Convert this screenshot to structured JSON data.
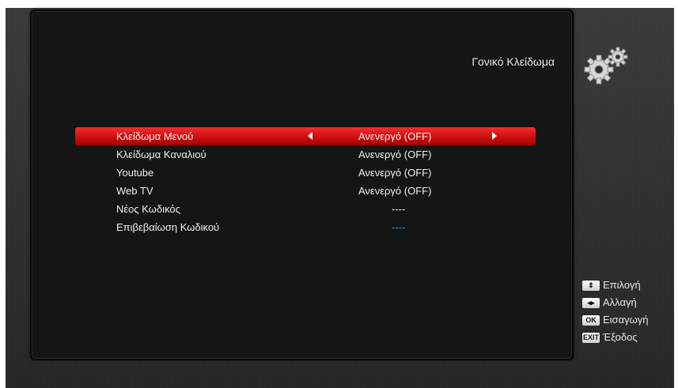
{
  "header": {
    "title": "Γονικό Κλείδωμα",
    "icon": "gears-icon"
  },
  "menu": {
    "items": [
      {
        "label": "Κλείδωμα Μενού",
        "value": "Ανενεργό (OFF)",
        "selected": true
      },
      {
        "label": "Κλείδωμα Καναλιού",
        "value": "Ανενεργό (OFF)"
      },
      {
        "label": "Youtube",
        "value": "Ανενεργό (OFF)"
      },
      {
        "label": "Web TV",
        "value": "Ανενεργό (OFF)"
      },
      {
        "label": "Νέος Κωδικός",
        "value": "----"
      },
      {
        "label": "Επιβεβαίωση Κωδικού",
        "value": "----",
        "value_color": "#2f8fff"
      }
    ]
  },
  "legend": {
    "select": {
      "key": "⇕",
      "label": "Επιλογή"
    },
    "change": {
      "key": "◂▸",
      "label": "Αλλαγή"
    },
    "ok": {
      "key": "OK",
      "label": "Εισαγωγή"
    },
    "exit": {
      "key": "EXIT",
      "label": "Έξοδος"
    }
  },
  "colors": {
    "selection": "#d01010",
    "background": "#2e2e2e",
    "panel": "#151515",
    "code_highlight": "#2f8fff"
  }
}
